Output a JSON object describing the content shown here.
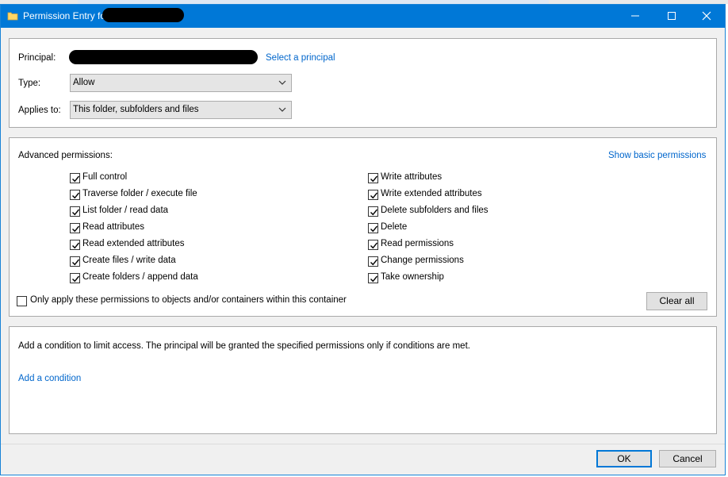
{
  "window": {
    "title": "Permission Entry fo",
    "minimize_icon": "minimize-icon",
    "maximize_icon": "maximize-icon",
    "close_icon": "close-icon"
  },
  "principal_section": {
    "principal_label": "Principal:",
    "select_principal_link": "Select a principal",
    "type_label": "Type:",
    "type_value": "Allow",
    "applies_label": "Applies to:",
    "applies_value": "This folder, subfolders and files"
  },
  "advanced": {
    "heading": "Advanced permissions:",
    "show_basic_link": "Show basic permissions",
    "left_permissions": [
      {
        "label": "Full control",
        "checked": true
      },
      {
        "label": "Traverse folder / execute file",
        "checked": true
      },
      {
        "label": "List folder / read data",
        "checked": true
      },
      {
        "label": "Read attributes",
        "checked": true
      },
      {
        "label": "Read extended attributes",
        "checked": true
      },
      {
        "label": "Create files / write data",
        "checked": true
      },
      {
        "label": "Create folders / append data",
        "checked": true
      }
    ],
    "right_permissions": [
      {
        "label": "Write attributes",
        "checked": true
      },
      {
        "label": "Write extended attributes",
        "checked": true
      },
      {
        "label": "Delete subfolders and files",
        "checked": true
      },
      {
        "label": "Delete",
        "checked": true
      },
      {
        "label": "Read permissions",
        "checked": true
      },
      {
        "label": "Change permissions",
        "checked": true
      },
      {
        "label": "Take ownership",
        "checked": true
      }
    ],
    "only_apply_label": "Only apply these permissions to objects and/or containers within this container",
    "only_apply_checked": false,
    "clear_all_label": "Clear all"
  },
  "condition": {
    "description": "Add a condition to limit access. The principal will be granted the specified permissions only if conditions are met.",
    "add_condition_link": "Add a condition"
  },
  "footer": {
    "ok_label": "OK",
    "cancel_label": "Cancel"
  },
  "colors": {
    "title_bar": "#0078d7",
    "link": "#0066cc"
  }
}
